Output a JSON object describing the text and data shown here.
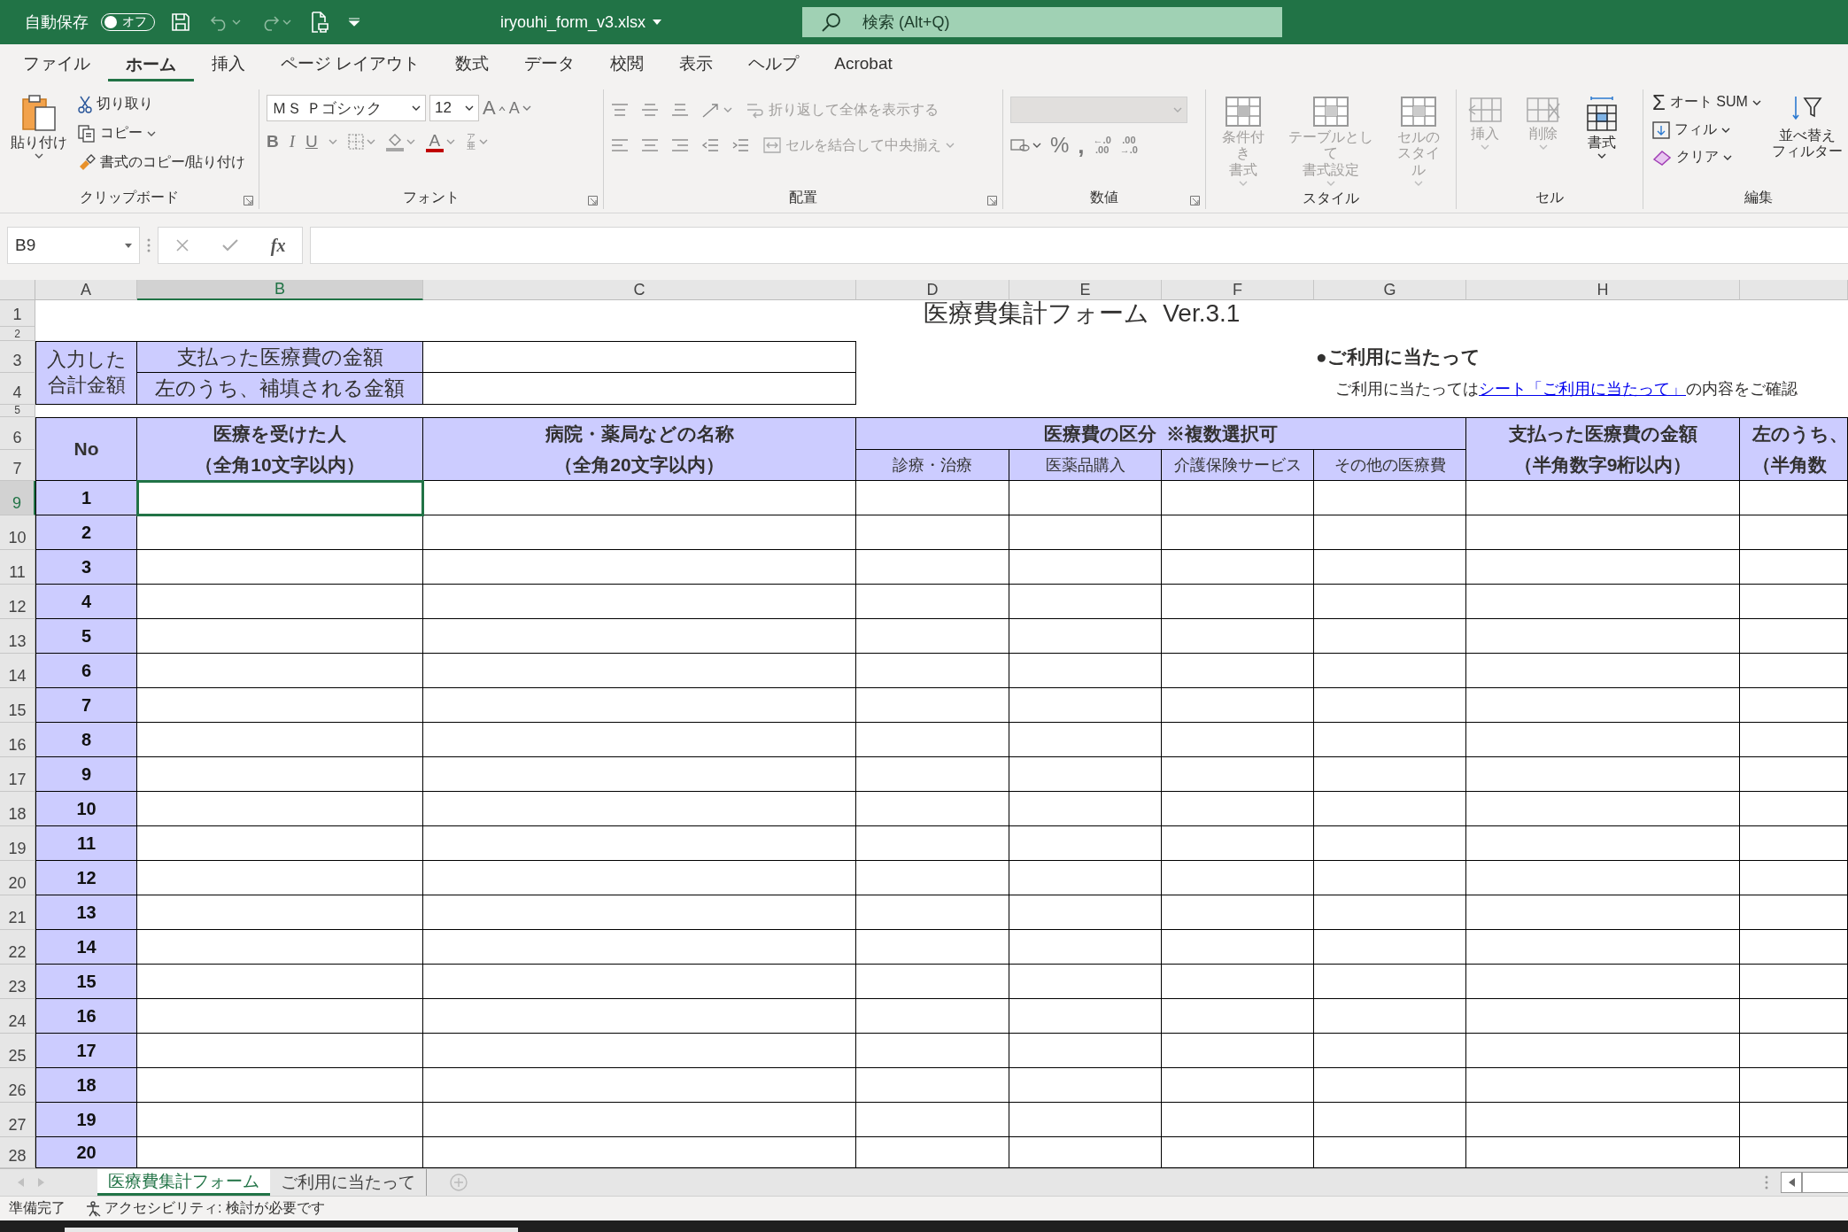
{
  "title_bar": {
    "autosave_label": "自動保存",
    "autosave": {
      "label": "オフ",
      "on": false
    },
    "filename": "iryouhi_form_v3.xlsx",
    "search": {
      "placeholder": "検索 (Alt+Q)"
    }
  },
  "ribbon_tabs": [
    {
      "label": "ファイル",
      "selected": false
    },
    {
      "label": "ホーム",
      "selected": true
    },
    {
      "label": "挿入",
      "selected": false
    },
    {
      "label": "ページ レイアウト",
      "selected": false
    },
    {
      "label": "数式",
      "selected": false
    },
    {
      "label": "データ",
      "selected": false
    },
    {
      "label": "校閲",
      "selected": false
    },
    {
      "label": "表示",
      "selected": false
    },
    {
      "label": "ヘルプ",
      "selected": false
    },
    {
      "label": "Acrobat",
      "selected": false
    }
  ],
  "ribbon": {
    "clipboard": {
      "paste": "貼り付け",
      "items": [
        {
          "kind": "cut",
          "label": "切り取り"
        },
        {
          "kind": "copy",
          "label": "コピー"
        },
        {
          "kind": "format_painter",
          "label": "書式のコピー/貼り付け"
        }
      ],
      "label": "クリップボード"
    },
    "font": {
      "name": "ＭＳ Ｐゴシック",
      "size": "12",
      "grow": "A",
      "shrink": "A",
      "bold": "B",
      "italic": "I",
      "underline": "U",
      "font_color": "A",
      "phonetic": "ア亜",
      "label": "フォント"
    },
    "alignment": {
      "wrap": {
        "label": "折り返して全体を表示する",
        "disabled": true
      },
      "merge": {
        "label": "セルを結合して中央揃え",
        "disabled": true
      },
      "label": "配置"
    },
    "number": {
      "percent": "%",
      "comma": ",",
      "decimals": [
        {
          "top": "←.0",
          "bottom": ".00"
        },
        {
          "top": ".00",
          "bottom": "→.0"
        }
      ],
      "label": "数値"
    },
    "styles": {
      "items": [
        {
          "lines": [
            "条件付き",
            "書式"
          ],
          "disabled": true
        },
        {
          "lines": [
            "テーブルとして",
            "書式設定"
          ],
          "disabled": true
        },
        {
          "lines": [
            "セルの",
            "スタイル"
          ],
          "disabled": true
        }
      ],
      "label": "スタイル"
    },
    "cells": {
      "items": [
        {
          "kind": "insert",
          "label": "挿入",
          "disabled": true
        },
        {
          "kind": "delete",
          "label": "削除",
          "disabled": true
        },
        {
          "kind": "format",
          "label": "書式",
          "disabled": false
        }
      ],
      "label": "セル"
    },
    "editing": {
      "items": [
        {
          "kind": "autosum",
          "icon": "Σ",
          "label": "オート SUM"
        },
        {
          "kind": "fill",
          "label": "フィル"
        },
        {
          "kind": "clear",
          "label": "クリア"
        }
      ],
      "sort_filter": [
        "並べ替え",
        "フィルター"
      ],
      "label": "編集"
    }
  },
  "formula_bar": {
    "name_box": "B9",
    "function_label": "fx"
  },
  "columns": [
    {
      "label": "A",
      "selected": false
    },
    {
      "label": "B",
      "selected": true
    },
    {
      "label": "C",
      "selected": false
    },
    {
      "label": "D",
      "selected": false
    },
    {
      "label": "E",
      "selected": false
    },
    {
      "label": "F",
      "selected": false
    },
    {
      "label": "G",
      "selected": false
    },
    {
      "label": "H",
      "selected": false
    }
  ],
  "row_headers": [
    {
      "label": "1",
      "selected": false
    },
    {
      "label": "2",
      "selected": false
    },
    {
      "label": "3",
      "selected": false
    },
    {
      "label": "4",
      "selected": false
    },
    {
      "label": "5",
      "selected": false
    },
    {
      "label": "6",
      "selected": false
    },
    {
      "label": "7",
      "selected": false
    },
    {
      "label": "9",
      "selected": true
    },
    {
      "label": "10",
      "selected": false
    },
    {
      "label": "11",
      "selected": false
    },
    {
      "label": "12",
      "selected": false
    },
    {
      "label": "13",
      "selected": false
    },
    {
      "label": "14",
      "selected": false
    },
    {
      "label": "15",
      "selected": false
    },
    {
      "label": "16",
      "selected": false
    },
    {
      "label": "17",
      "selected": false
    },
    {
      "label": "18",
      "selected": false
    },
    {
      "label": "19",
      "selected": false
    },
    {
      "label": "20",
      "selected": false
    },
    {
      "label": "21",
      "selected": false
    },
    {
      "label": "22",
      "selected": false
    },
    {
      "label": "23",
      "selected": false
    },
    {
      "label": "24",
      "selected": false
    },
    {
      "label": "25",
      "selected": false
    },
    {
      "label": "26",
      "selected": false
    },
    {
      "label": "27",
      "selected": false
    },
    {
      "label": "28",
      "selected": false
    }
  ],
  "sheet": {
    "title": "医療費集計フォーム  Ver.3.1",
    "totals": {
      "heading": "入力した合計金額",
      "rows": [
        "支払った医療費の金額",
        "左のうち、補填される金額"
      ]
    },
    "notice": {
      "heading": "●ご利用に当たって",
      "before": "ご利用に当たっては",
      "link": "シート「ご利用に当たって」",
      "after": "の内容をご確認"
    },
    "headers": {
      "no": "No",
      "person": [
        "医療を受けた人",
        "（全角10文字以内）"
      ],
      "facility": [
        "病院・薬局などの名称",
        "（全角20文字以内）"
      ],
      "category": "医療費の区分  ※複数選択可",
      "subcategories": [
        "診療・治療",
        "医薬品購入",
        "介護保険サービス",
        "その他の医療費"
      ],
      "paid": [
        "支払った医療費の金額",
        "（半角数字9桁以内）"
      ],
      "compensated": [
        "左のうち、",
        "（半角数"
      ]
    },
    "rows": [
      {
        "no": "1"
      },
      {
        "no": "2"
      },
      {
        "no": "3"
      },
      {
        "no": "4"
      },
      {
        "no": "5"
      },
      {
        "no": "6"
      },
      {
        "no": "7"
      },
      {
        "no": "8"
      },
      {
        "no": "9"
      },
      {
        "no": "10"
      },
      {
        "no": "11"
      },
      {
        "no": "12"
      },
      {
        "no": "13"
      },
      {
        "no": "14"
      },
      {
        "no": "15"
      },
      {
        "no": "16"
      },
      {
        "no": "17"
      },
      {
        "no": "18"
      },
      {
        "no": "19"
      },
      {
        "no": "20"
      }
    ]
  },
  "sheet_tabs": [
    {
      "label": "医療費集計フォーム",
      "selected": true
    },
    {
      "label": "ご利用に当たって",
      "selected": false
    }
  ],
  "status_bar": {
    "ready": "準備完了",
    "accessibility": "アクセシビリティ: 検討が必要です"
  }
}
